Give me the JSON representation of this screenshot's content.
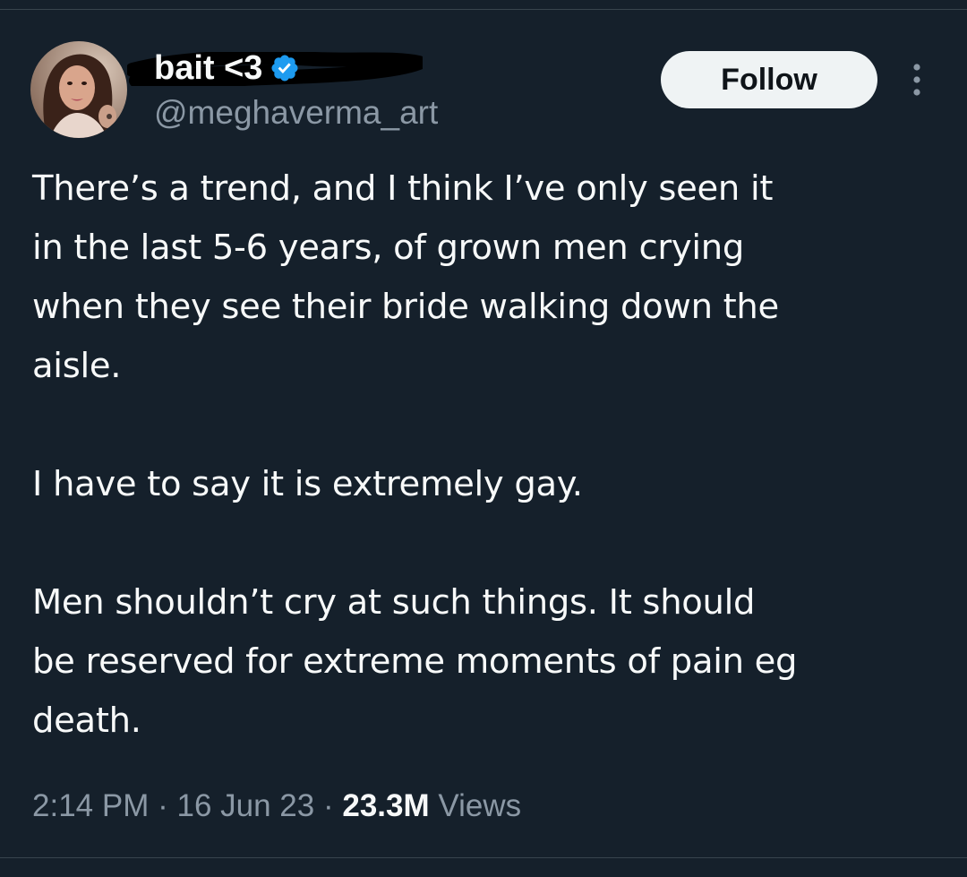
{
  "author": {
    "display_name": "bait <3",
    "handle": "@meghaverma_art",
    "verified": true,
    "avatar": "profile-photo"
  },
  "actions": {
    "follow_label": "Follow",
    "more_icon": "more-vertical-icon"
  },
  "tweet": {
    "text": "There’s a trend, and I think I’ve only seen it\nin the last 5-6 years, of grown men crying\nwhen they see their bride walking down the\naisle.\n\nI have to say it is extremely gay.\n\nMen shouldn’t cry at such things. It should\nbe reserved for extreme moments of pain eg\ndeath."
  },
  "meta": {
    "time": "2:14 PM",
    "separator": "·",
    "date": "16 Jun 23",
    "views_count": "23.3M",
    "views_label": "Views"
  },
  "colors": {
    "background": "#15202b",
    "text_primary": "#f7f9f9",
    "text_secondary": "#8b98a5",
    "verified_blue": "#1d9bf0",
    "follow_button_bg": "#eff3f4"
  }
}
